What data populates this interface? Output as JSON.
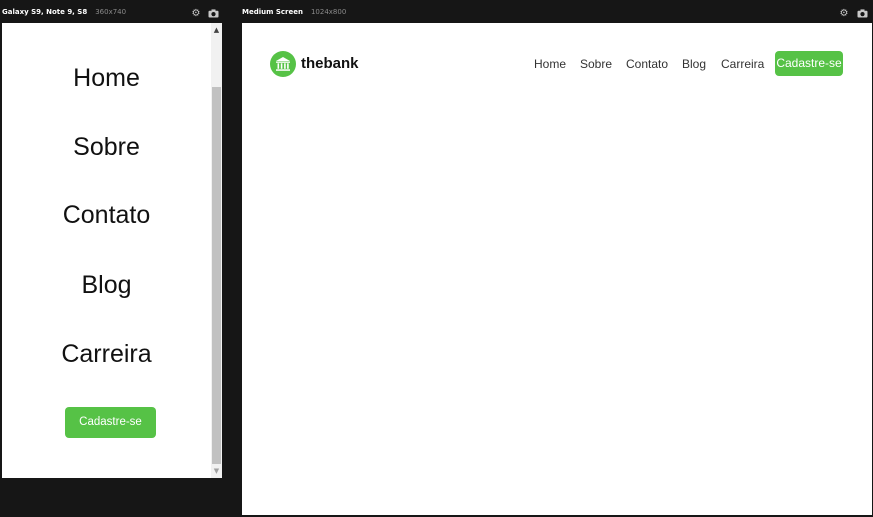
{
  "devices": [
    {
      "name": "Galaxy S9, Note 9, S8",
      "size": "360x740"
    },
    {
      "name": "Medium Screen",
      "size": "1024x800"
    }
  ],
  "icons": {
    "settings": "gear-icon",
    "screenshot": "camera-icon",
    "logo": "bank-icon"
  },
  "colors": {
    "accent": "#56c246",
    "chrome": "#161616"
  },
  "brand": {
    "name": "thebank"
  },
  "nav": {
    "items": [
      "Home",
      "Sobre",
      "Contato",
      "Blog",
      "Carreira"
    ],
    "cta": "Cadastre-se"
  }
}
